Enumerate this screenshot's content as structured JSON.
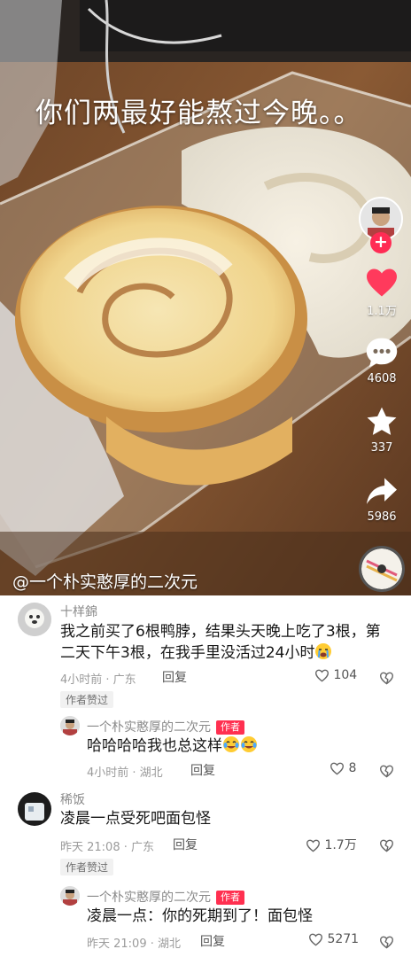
{
  "video": {
    "caption": "你们两最好能熬过今晚。。",
    "author_handle": "@一个朴实憨厚的二次元",
    "actions": {
      "likes": "1.1万",
      "comments": "4608",
      "favorites": "337",
      "shares": "5986"
    }
  },
  "comments": [
    {
      "user": "十样錦",
      "text": "我之前买了6根鸭脖，结果头天晚上吃了3根，第二天下午3根，在我手里没活过24小时",
      "time_location": "4小时前 · 广东",
      "reply_label": "回复",
      "likes": "104",
      "liked_by_author": "作者赞过",
      "reply": {
        "user": "一个朴实憨厚的二次元",
        "author_badge": "作者",
        "text": "哈哈哈哈我也总这样",
        "time_location": "4小时前 · 湖北",
        "reply_label": "回复",
        "likes": "8"
      }
    },
    {
      "user": "稀饭",
      "text": "凌晨一点受死吧面包怪",
      "time_location": "昨天 21:08 · 广东",
      "reply_label": "回复",
      "likes": "1.7万",
      "liked_by_author": "作者赞过",
      "reply": {
        "user": "一个朴实憨厚的二次元",
        "author_badge": "作者",
        "text": "凌晨一点：你的死期到了！面包怪",
        "time_location": "昨天 21:09 · 湖北",
        "reply_label": "回复",
        "likes": "5271"
      }
    }
  ],
  "colors": {
    "accent": "#ff2b54",
    "like_heart": "#ff3a5c",
    "author_badge": "#ff3050"
  },
  "icons": [
    "heart-icon",
    "comment-bubble-icon",
    "star-icon",
    "share-arrow-icon",
    "follow-plus-icon",
    "like-heart-outline-icon",
    "dislike-broken-heart-icon",
    "cry-laugh-emoji",
    "sob-emoji"
  ]
}
